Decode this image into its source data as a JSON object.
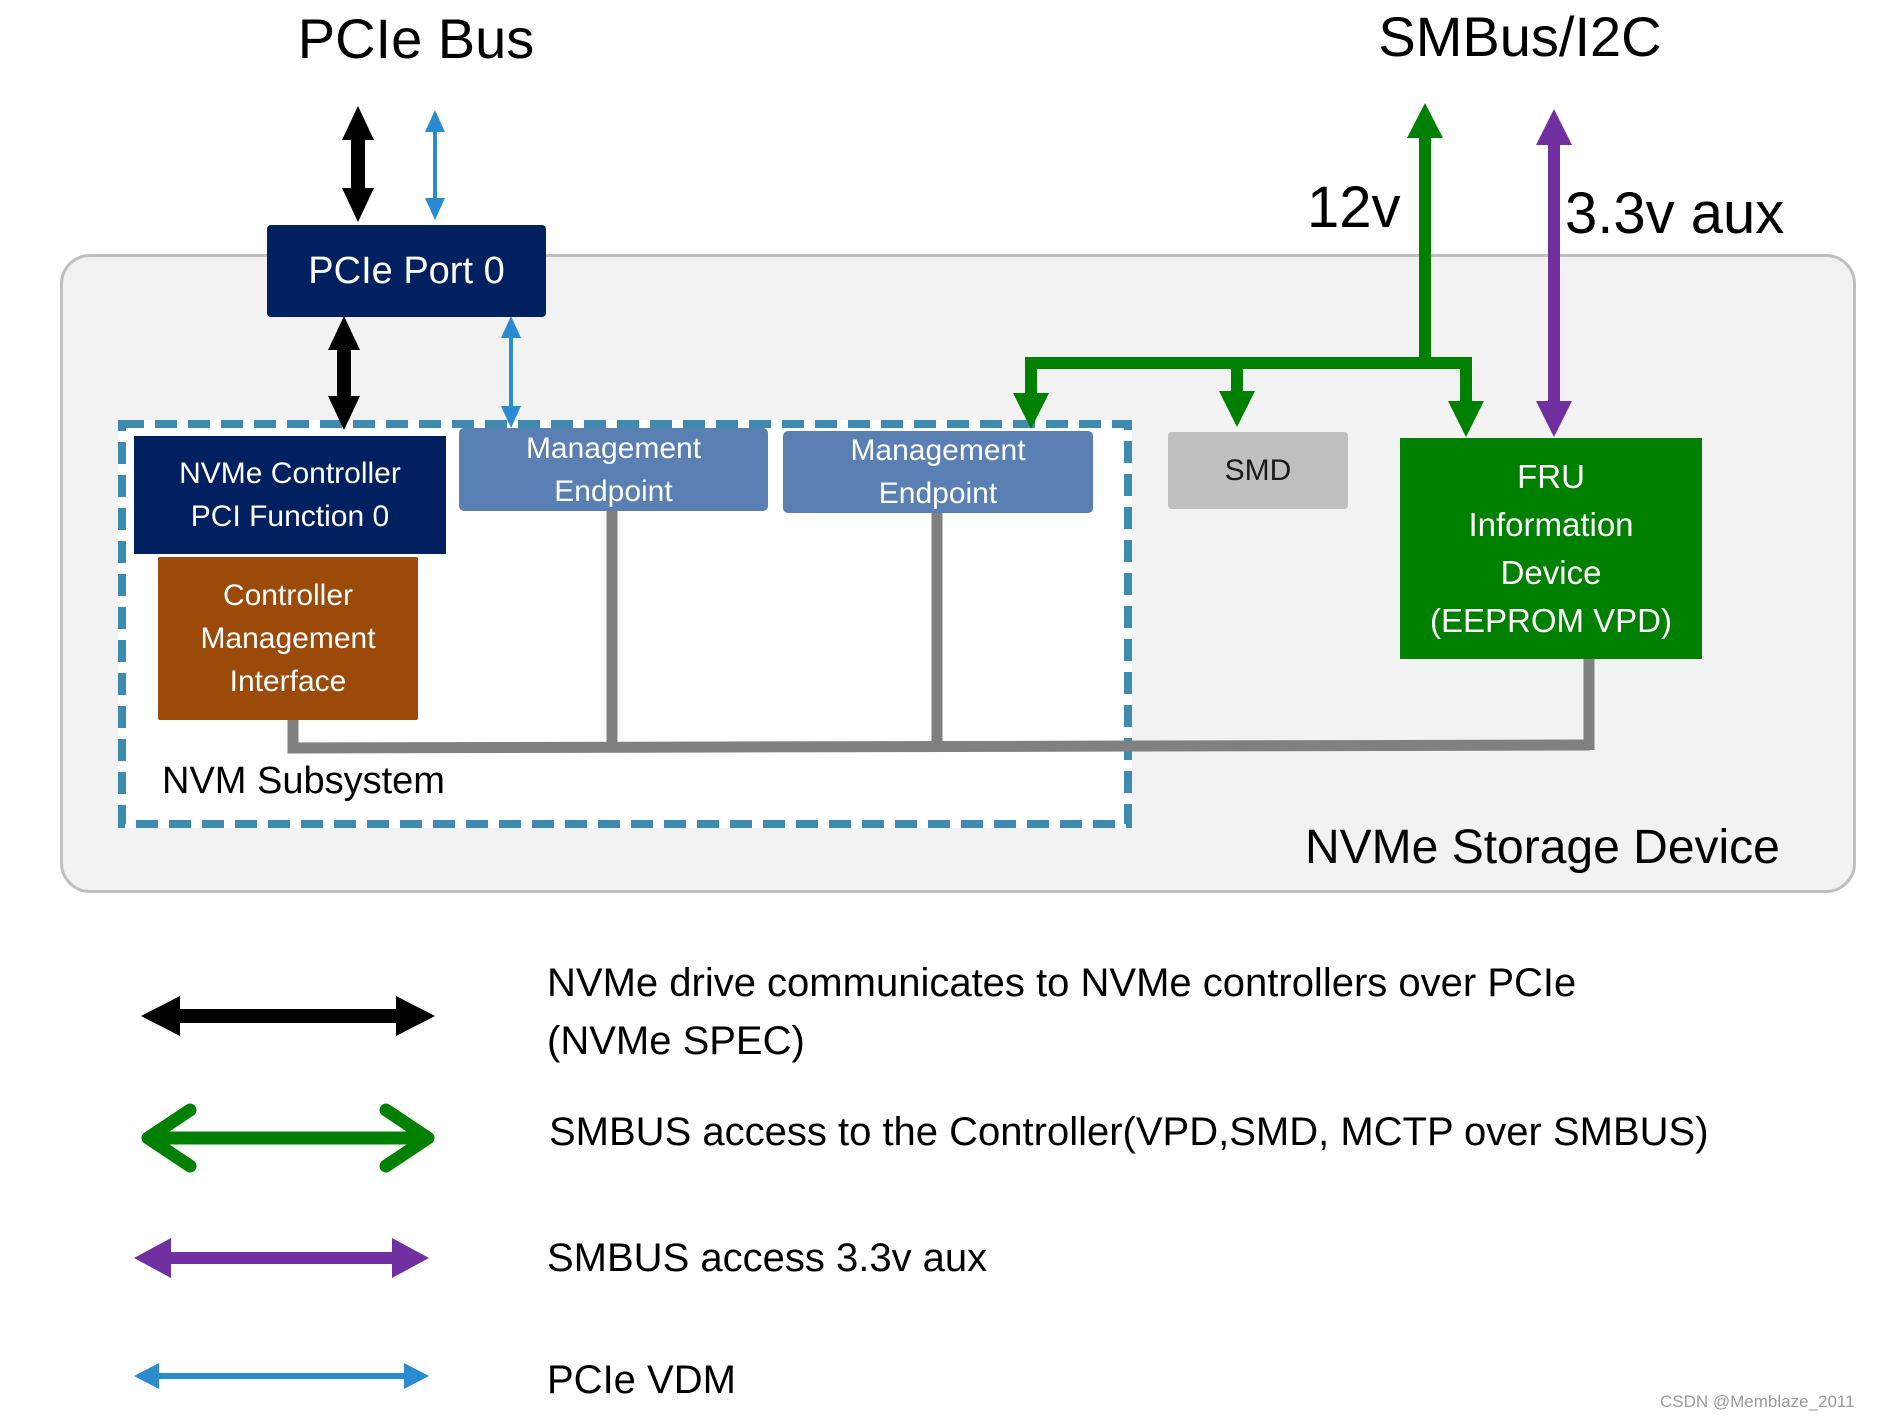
{
  "titles": {
    "pcie_bus": "PCIe Bus",
    "smbus": "SMBus/I2C"
  },
  "power_labels": {
    "v12": "12v",
    "v33aux": "3.3v aux"
  },
  "containers": {
    "storage_device": "NVMe Storage Device",
    "nvm_subsystem": "NVM Subsystem"
  },
  "blocks": {
    "pcie_port": "PCIe Port 0",
    "nvme_controller": "NVMe Controller\nPCI Function 0",
    "cmi": "Controller\nManagement\nInterface",
    "mgmt_endpoint_1": "Management\nEndpoint",
    "mgmt_endpoint_2": "Management\nEndpoint",
    "smd": "SMD",
    "fru": "FRU\nInformation\nDevice\n(EEPROM VPD)"
  },
  "colors": {
    "pcie_black": "#000000",
    "pcie_vdm_blue": "#2A8BD0",
    "smbus_green": "#008000",
    "aux_purple": "#7030A0",
    "mctp_gray": "#808080",
    "subsystem_dash": "#3E8BAF",
    "navy": "#002060",
    "endpoint_blue": "#5A7FB3",
    "cmi_brown": "#9C4A0A",
    "smd_gray": "#BFBFBF"
  },
  "legend": [
    {
      "icon": "black-double-arrow",
      "line1": "NVMe drive communicates to NVMe controllers over PCIe",
      "line2": "(NVMe SPEC)"
    },
    {
      "icon": "green-double-arrow",
      "line1": "SMBUS access to the Controller(VPD,SMD, MCTP over SMBUS)"
    },
    {
      "icon": "purple-double-arrow",
      "line1": "SMBUS access 3.3v aux"
    },
    {
      "icon": "blue-double-arrow",
      "line1": "PCIe VDM"
    }
  ],
  "watermark": "CSDN @Memblaze_2011"
}
